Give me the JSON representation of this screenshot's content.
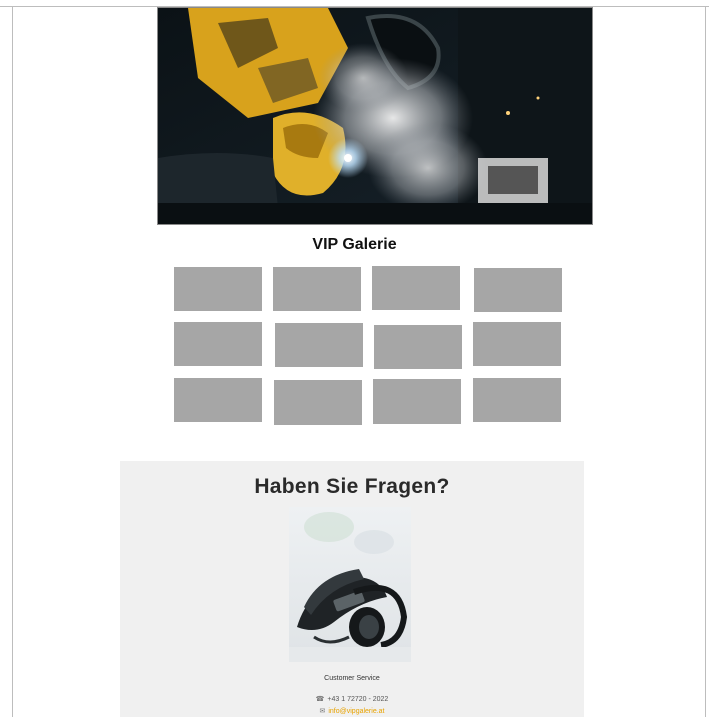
{
  "gallery": {
    "title": "VIP Galerie",
    "thumbnail_count": 12
  },
  "contact": {
    "title": "Haben Sie Fragen?",
    "service_label": "Customer Service",
    "phone_icon": "phone-icon",
    "phone": "+43 1 72720 - 2022",
    "mail_icon": "mail-icon",
    "email": "info@vipgalerie.at"
  },
  "colors": {
    "thumbnail": "#a6a6a6",
    "contact_bg": "#f0f0f0",
    "link": "#e8a300"
  }
}
